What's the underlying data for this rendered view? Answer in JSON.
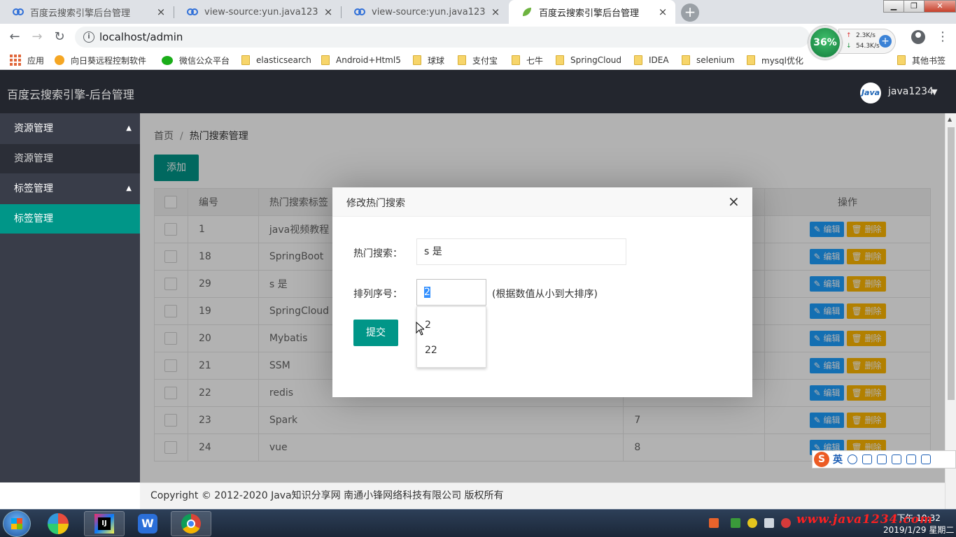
{
  "browser": {
    "tabs": [
      {
        "title": "百度云搜索引擎后台管理",
        "icon": "baidu-cloud-icon",
        "active": false
      },
      {
        "title": "view-source:yun.java1234.com",
        "icon": "baidu-cloud-icon",
        "active": false
      },
      {
        "title": "view-source:yun.java1234.com",
        "icon": "baidu-cloud-icon",
        "active": false
      },
      {
        "title": "百度云搜索引擎后台管理",
        "icon": "leaf-icon",
        "active": true
      }
    ],
    "url": "localhost/admin",
    "net_gauge": {
      "percent": "36%",
      "up": "2.3K/s",
      "down": "54.3K/s"
    },
    "bookmarks": [
      "应用",
      "向日葵远程控制软件",
      "微信公众平台",
      "elasticsearch",
      "Android+Html5",
      "球球",
      "支付宝",
      "七牛",
      "SpringCloud",
      "IDEA",
      "selenium",
      "mysql优化",
      "其他书签"
    ]
  },
  "app": {
    "title": "百度云搜索引擎-后台管理",
    "avatar_text": "Java",
    "user": "java1234",
    "sidebar": [
      {
        "group": "资源管理",
        "item": "资源管理",
        "active": false
      },
      {
        "group": "标签管理",
        "item": "标签管理",
        "active": true
      }
    ],
    "breadcrumb": {
      "home": "首页",
      "sep": "/",
      "current": "热门搜索管理"
    },
    "add_label": "添加",
    "table": {
      "headers": [
        "编号",
        "热门搜索标签",
        "",
        "操作"
      ],
      "edit_label": "编辑",
      "delete_label": "删除",
      "rows": [
        {
          "id": "1",
          "name": "java视频教程",
          "sort": ""
        },
        {
          "id": "18",
          "name": "SpringBoot",
          "sort": ""
        },
        {
          "id": "29",
          "name": "s 是",
          "sort": ""
        },
        {
          "id": "19",
          "name": "SpringCloud",
          "sort": ""
        },
        {
          "id": "20",
          "name": "Mybatis",
          "sort": ""
        },
        {
          "id": "21",
          "name": "SSM",
          "sort": ""
        },
        {
          "id": "22",
          "name": "redis",
          "sort": ""
        },
        {
          "id": "23",
          "name": "Spark",
          "sort": "7"
        },
        {
          "id": "24",
          "name": "vue",
          "sort": "8"
        }
      ]
    },
    "footer": "Copyright © 2012-2020 Java知识分享网 南通小锋网络科技有限公司 版权所有"
  },
  "modal": {
    "title": "修改热门搜索",
    "close": "×",
    "keyword_label": "热门搜索：",
    "keyword_value": "s 是",
    "sort_label": "排列序号：",
    "sort_value": "2",
    "sort_hint": "(根据数值从小到大排序)",
    "submit_label": "提交",
    "suggestions": [
      "2",
      "22"
    ]
  },
  "ime": {
    "logo": "S",
    "lang": "英"
  },
  "taskbar": {
    "time": "下午 10:32",
    "date": "2019/1/29 星期二",
    "watermark": "www.java1234.com"
  }
}
